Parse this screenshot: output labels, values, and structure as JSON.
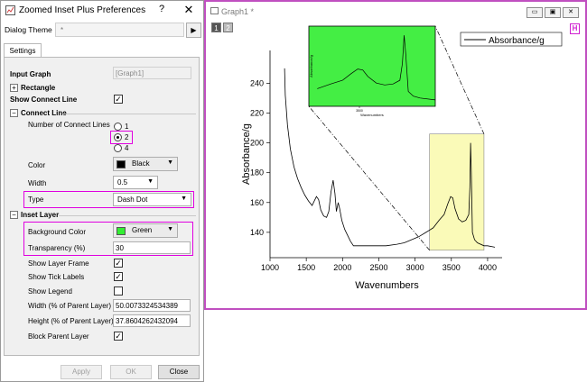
{
  "dialog": {
    "title": "Zoomed Inset Plus Preferences",
    "help": "?",
    "close": "✕",
    "theme_label": "Dialog Theme",
    "theme_value": "*",
    "theme_arrow": "▶",
    "tab": "Settings",
    "input_graph_label": "Input Graph",
    "input_graph_value": "[Graph1]",
    "rectangle_label": "Rectangle",
    "show_connect_label": "Show Connect Line",
    "connect_section": "Connect Line",
    "num_lines_label": "Number of Connect Lines",
    "opt1": "1",
    "opt2": "2",
    "opt4": "4",
    "color_label": "Color",
    "color_value": "Black",
    "width_label": "Width",
    "width_value": "0.5",
    "type_label": "Type",
    "type_value": "Dash Dot",
    "inset_section": "Inset Layer",
    "bg_label": "Background Color",
    "bg_value": "Green",
    "transp_label": "Transparency (%)",
    "transp_value": "30",
    "show_frame_label": "Show Layer Frame",
    "show_tick_label": "Show Tick Labels",
    "show_legend_label": "Show Legend",
    "width_pct_label": "Width (% of Parent Layer)",
    "width_pct_value": "50.0073324534389",
    "height_pct_label": "Height (% of Parent Layer)",
    "height_pct_value": "37.8604262432094",
    "block_parent_label": "Block Parent Layer",
    "apply": "Apply",
    "ok": "OK",
    "close_btn": "Close",
    "checked_mark": "✓",
    "collapse_mark": "−",
    "expand_mark": "+",
    "dropdown_mark": "▼"
  },
  "graph_window": {
    "title": "Graph1 *",
    "layer1": "1",
    "layer2": "2",
    "h_icon": "H",
    "minimize": "▭",
    "restore": "▣",
    "close": "✕"
  },
  "colors": {
    "accent": "#e000e0",
    "inset_bg": "#44ee44",
    "zoom_rect": "#fafab8",
    "black_swatch": "#000000",
    "green_swatch": "#33ee33"
  },
  "chart_data": {
    "type": "line",
    "title": "",
    "xlabel": "Wavenumbers",
    "ylabel": "Absorbance/g",
    "legend": "Absorbance/g",
    "legend_position": "top-right",
    "xlim": [
      1000,
      4200
    ],
    "ylim": [
      123,
      262
    ],
    "xticks": [
      1000,
      1500,
      2000,
      2500,
      3000,
      3500,
      4000
    ],
    "yticks": [
      140,
      160,
      180,
      200,
      220,
      240
    ],
    "series": [
      {
        "name": "Absorbance/g",
        "points": [
          [
            1200,
            250
          ],
          [
            1210,
            232
          ],
          [
            1240,
            212
          ],
          [
            1280,
            196
          ],
          [
            1330,
            184
          ],
          [
            1380,
            176
          ],
          [
            1430,
            170
          ],
          [
            1480,
            165
          ],
          [
            1530,
            161
          ],
          [
            1580,
            158
          ],
          [
            1610,
            161
          ],
          [
            1640,
            164
          ],
          [
            1670,
            162
          ],
          [
            1700,
            155
          ],
          [
            1740,
            151
          ],
          [
            1780,
            150
          ],
          [
            1810,
            154
          ],
          [
            1840,
            167
          ],
          [
            1870,
            175
          ],
          [
            1895,
            166
          ],
          [
            1915,
            154
          ],
          [
            1940,
            160
          ],
          [
            1960,
            156
          ],
          [
            1990,
            148
          ],
          [
            2030,
            142
          ],
          [
            2070,
            138
          ],
          [
            2110,
            134
          ],
          [
            2150,
            131
          ],
          [
            2200,
            131
          ],
          [
            2300,
            131
          ],
          [
            2450,
            131
          ],
          [
            2600,
            131
          ],
          [
            2750,
            132
          ],
          [
            2850,
            133
          ],
          [
            2950,
            135
          ],
          [
            3050,
            137
          ],
          [
            3150,
            140
          ],
          [
            3250,
            143
          ],
          [
            3330,
            148
          ],
          [
            3400,
            152
          ],
          [
            3450,
            159
          ],
          [
            3490,
            164
          ],
          [
            3520,
            163
          ],
          [
            3550,
            156
          ],
          [
            3600,
            149
          ],
          [
            3650,
            147
          ],
          [
            3700,
            148
          ],
          [
            3740,
            152
          ],
          [
            3755,
            170
          ],
          [
            3765,
            200
          ],
          [
            3775,
            180
          ],
          [
            3790,
            140
          ],
          [
            3820,
            135
          ],
          [
            3860,
            133
          ],
          [
            3950,
            131
          ],
          [
            4000,
            131
          ],
          [
            4100,
            130
          ]
        ]
      }
    ],
    "zoom_region": {
      "x": [
        3200,
        3950
      ],
      "y": [
        128,
        206
      ]
    },
    "inset_xticks": [
      "3500"
    ],
    "inset_xlabel": "Wavenumbers",
    "inset_ylabel": "Absorbance/g"
  }
}
